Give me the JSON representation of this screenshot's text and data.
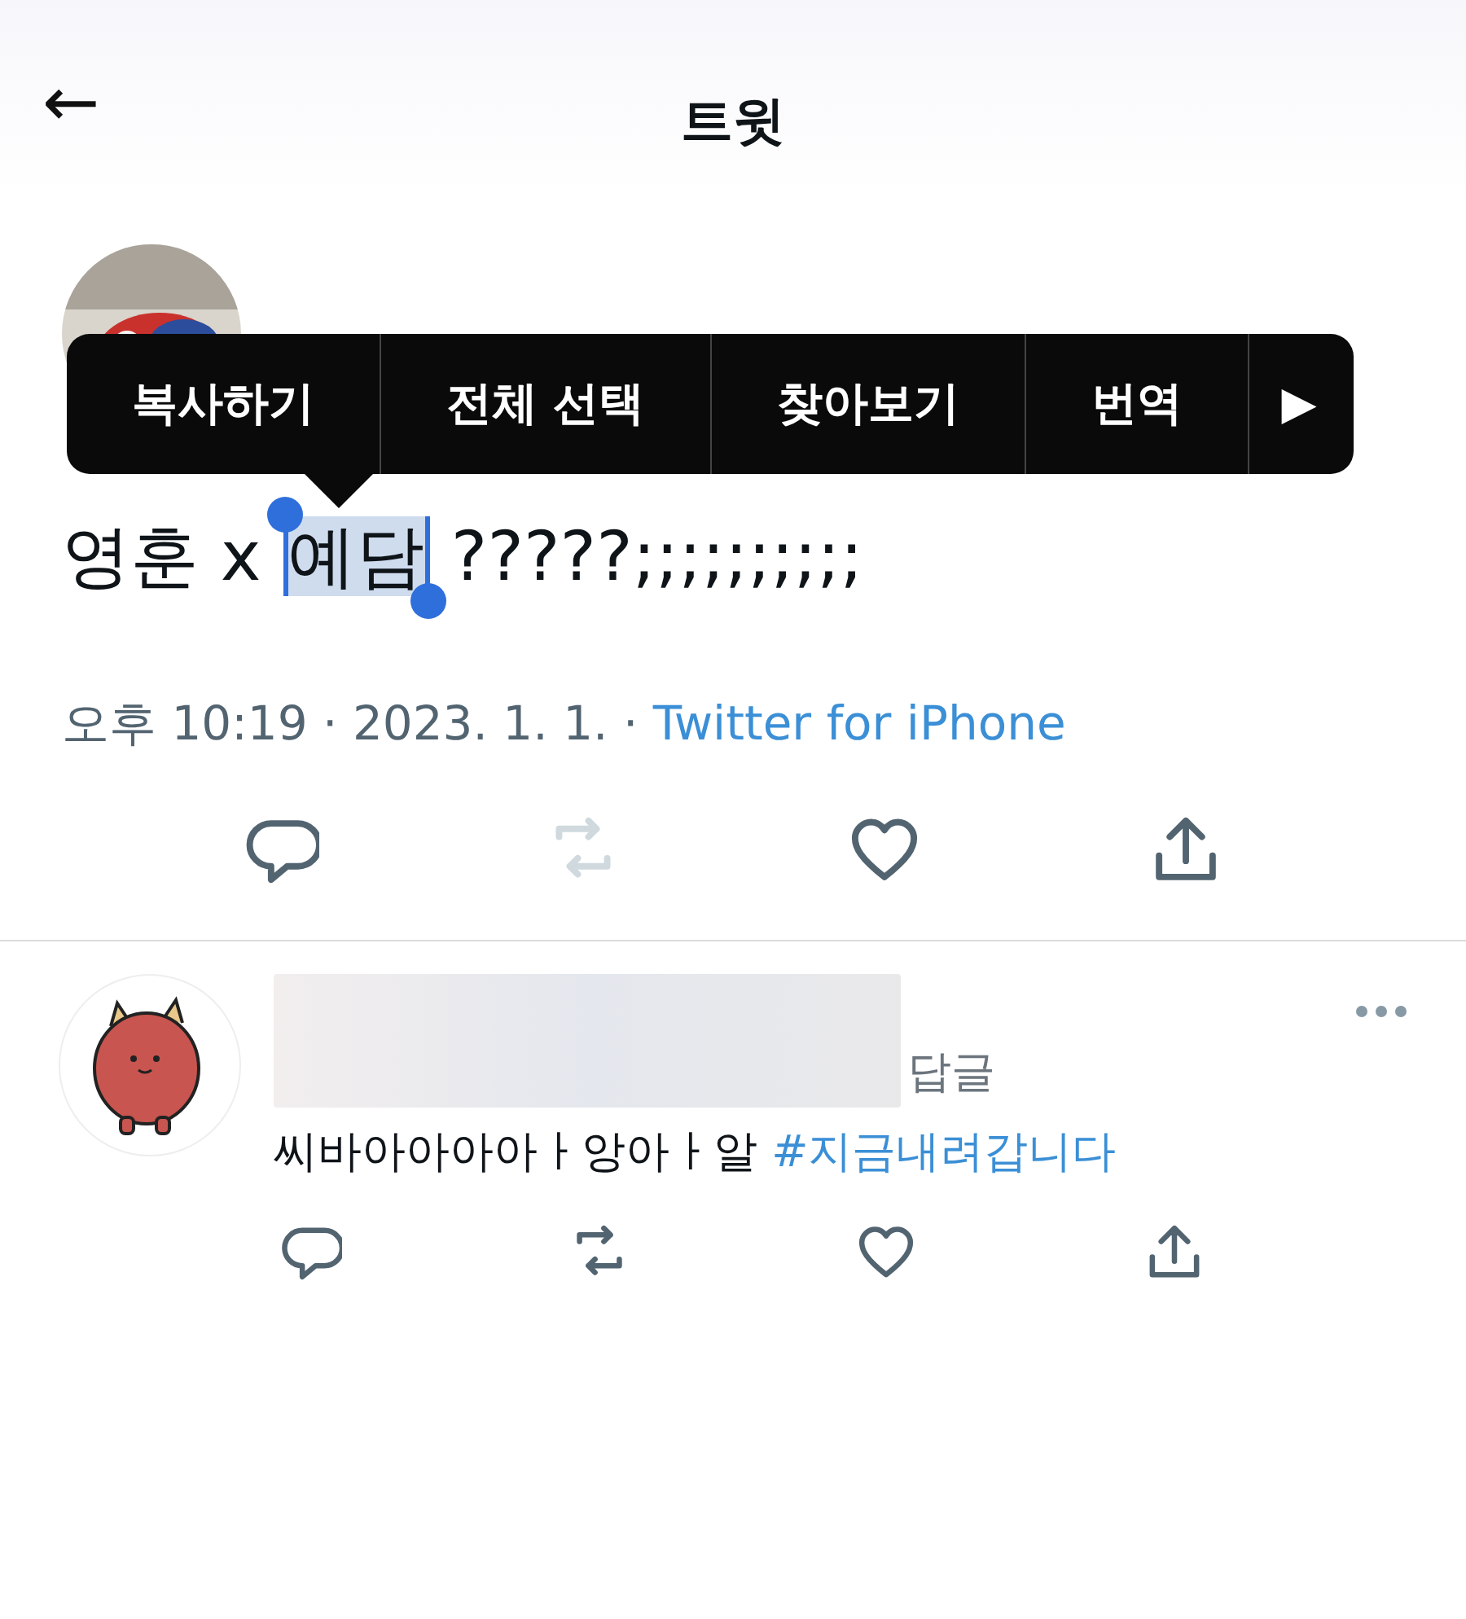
{
  "header": {
    "back": "←",
    "title": "트윗"
  },
  "context_menu": {
    "items": [
      "복사하기",
      "전체 선택",
      "찾아보기",
      "번역"
    ],
    "more": "▶"
  },
  "tweet": {
    "text_parts": [
      {
        "text": "영훈 x ",
        "selected": false
      },
      {
        "text": "예담",
        "selected": true
      },
      {
        "text": " ?????;;;;;;;;;;",
        "selected": false
      }
    ],
    "time": "오후 10:19 · 2023. 1. 1. · ",
    "source": "Twitter for iPhone",
    "actions": [
      {
        "kind": "reply",
        "disabled": false
      },
      {
        "kind": "retweet",
        "disabled": true
      },
      {
        "kind": "like",
        "disabled": false
      },
      {
        "kind": "share",
        "disabled": false
      }
    ]
  },
  "reply": {
    "reply_label": "답글",
    "text": "씨바아아아아ㅏ앙아ㅏ알 ",
    "hashtag": "#지금내려갑니다",
    "actions": [
      {
        "kind": "reply",
        "disabled": false
      },
      {
        "kind": "retweet",
        "disabled": false
      },
      {
        "kind": "like",
        "disabled": false
      },
      {
        "kind": "share",
        "disabled": false
      }
    ]
  }
}
